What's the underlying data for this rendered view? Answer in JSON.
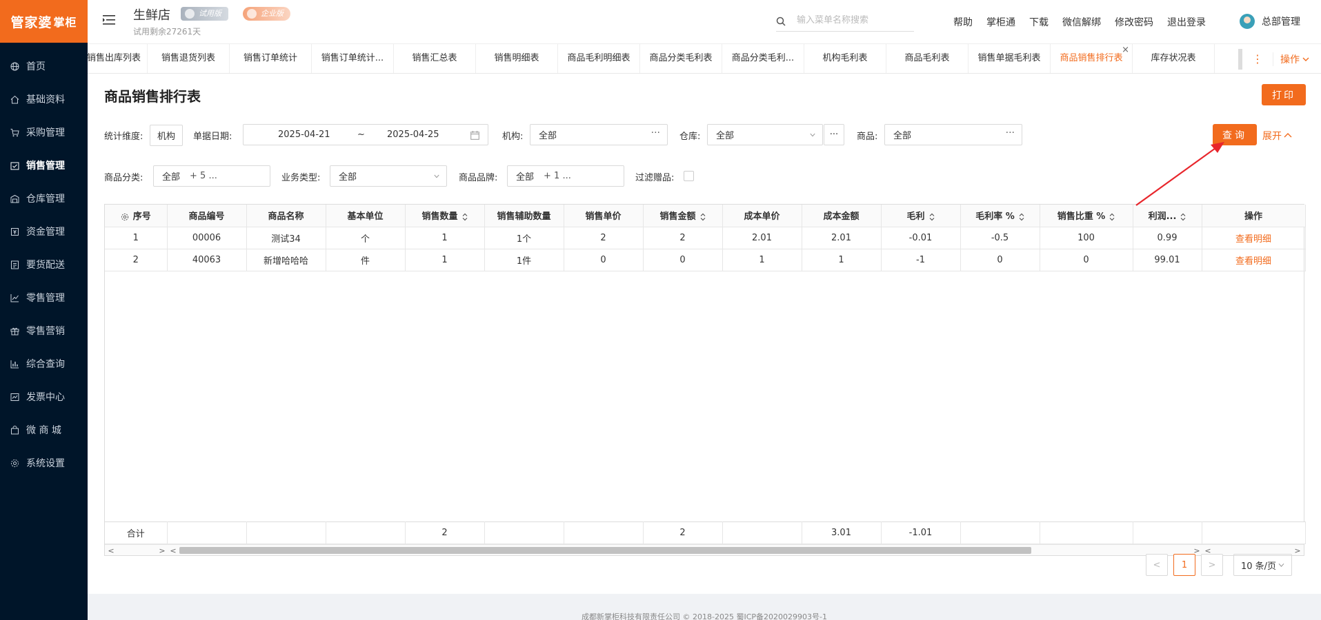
{
  "brand": {
    "logo_text": "管家婆",
    "logo_sub": "掌柜"
  },
  "sidebar": {
    "items": [
      {
        "label": "首页",
        "icon": "globe-icon",
        "active": false
      },
      {
        "label": "基础资料",
        "icon": "home-icon",
        "active": false
      },
      {
        "label": "采购管理",
        "icon": "cart-icon",
        "active": false
      },
      {
        "label": "销售管理",
        "icon": "sales-icon",
        "active": true
      },
      {
        "label": "仓库管理",
        "icon": "warehouse-icon",
        "active": false
      },
      {
        "label": "资金管理",
        "icon": "fund-icon",
        "active": false
      },
      {
        "label": "要货配送",
        "icon": "list-icon",
        "active": false
      },
      {
        "label": "零售管理",
        "icon": "chart-icon",
        "active": false
      },
      {
        "label": "零售营销",
        "icon": "gift-icon",
        "active": false
      },
      {
        "label": "综合查询",
        "icon": "bar-icon",
        "active": false
      },
      {
        "label": "发票中心",
        "icon": "invoice-icon",
        "active": false
      },
      {
        "label": "微 商 城",
        "icon": "bag-icon",
        "active": false
      },
      {
        "label": "系统设置",
        "icon": "gear-icon",
        "active": false
      }
    ]
  },
  "header": {
    "store_name": "生鲜店",
    "trial_badge": "试用版",
    "edition_badge": "企业版",
    "trial_remaining": "试用剩余27261天",
    "search_placeholder": "输入菜单名称搜索",
    "links": [
      "帮助",
      "掌柜通",
      "下载",
      "微信解绑",
      "修改密码",
      "退出登录"
    ],
    "user_name": "总部管理"
  },
  "tabs": {
    "items": [
      {
        "label": "销售出库列表",
        "active": false
      },
      {
        "label": "销售退货列表",
        "active": false
      },
      {
        "label": "销售订单统计",
        "active": false
      },
      {
        "label": "销售订单统计...",
        "active": false
      },
      {
        "label": "销售汇总表",
        "active": false
      },
      {
        "label": "销售明细表",
        "active": false
      },
      {
        "label": "商品毛利明细表",
        "active": false
      },
      {
        "label": "商品分类毛利表",
        "active": false
      },
      {
        "label": "商品分类毛利...",
        "active": false
      },
      {
        "label": "机构毛利表",
        "active": false
      },
      {
        "label": "商品毛利表",
        "active": false
      },
      {
        "label": "销售单据毛利表",
        "active": false
      },
      {
        "label": "商品销售排行表",
        "active": true
      },
      {
        "label": "库存状况表",
        "active": false
      }
    ],
    "ops_label": "操作",
    "close_glyph": "×",
    "more_glyph": "⋮"
  },
  "page": {
    "title": "商品销售排行表",
    "print_label": "打印",
    "query_label": "查询",
    "expand_label": "展开"
  },
  "filters": {
    "dimension_label": "统计维度:",
    "dimension_value": "机构",
    "date_label": "单据日期:",
    "date_from": "2025-04-21",
    "date_sep": "~",
    "date_to": "2025-04-25",
    "org_label": "机构:",
    "org_value": "全部",
    "warehouse_label": "仓库:",
    "warehouse_value": "全部",
    "product_label": "商品:",
    "product_value": "全部",
    "category_label": "商品分类:",
    "category_value": "全部",
    "category_extra": "+ 5 ...",
    "biz_type_label": "业务类型:",
    "biz_type_value": "全部",
    "brand_label": "商品品牌:",
    "brand_value": "全部",
    "brand_extra": "+ 1 ...",
    "filter_gifts_label": "过滤赠品:",
    "filter_gifts_checked": false,
    "dots_glyph": "···"
  },
  "table": {
    "columns": [
      "序号",
      "商品编号",
      "商品名称",
      "基本单位",
      "销售数量",
      "销售辅助数量",
      "销售单价",
      "销售金额",
      "成本单价",
      "成本金额",
      "毛利",
      "毛利率 %",
      "销售比重 %",
      "利润..."
    ],
    "sortable": [
      false,
      false,
      false,
      false,
      true,
      false,
      false,
      true,
      false,
      false,
      true,
      true,
      true,
      true
    ],
    "ops_header": "操作",
    "rows": [
      [
        "1",
        "00006",
        "测试34",
        "个",
        "1",
        "1个",
        "2",
        "2",
        "2.01",
        "2.01",
        "-0.01",
        "-0.5",
        "100",
        "0.99"
      ],
      [
        "2",
        "40063",
        "新增哈哈哈",
        "件",
        "1",
        "1件",
        "0",
        "0",
        "1",
        "1",
        "-1",
        "0",
        "0",
        "99.01"
      ]
    ],
    "row_action": "查看明细",
    "totals": [
      "合计",
      "",
      "",
      "",
      "2",
      "",
      "",
      "2",
      "",
      "3.01",
      "-1.01",
      "",
      "",
      ""
    ]
  },
  "pagination": {
    "current": "1",
    "page_size": "10 条/页",
    "prev_glyph": "<",
    "next_glyph": ">"
  },
  "footer": {
    "text": "成都新掌柜科技有限责任公司 © 2018-2025 蜀ICP备2020029903号-1"
  },
  "colors": {
    "accent": "#f26b1d",
    "sidebar_bg": "#001529"
  }
}
